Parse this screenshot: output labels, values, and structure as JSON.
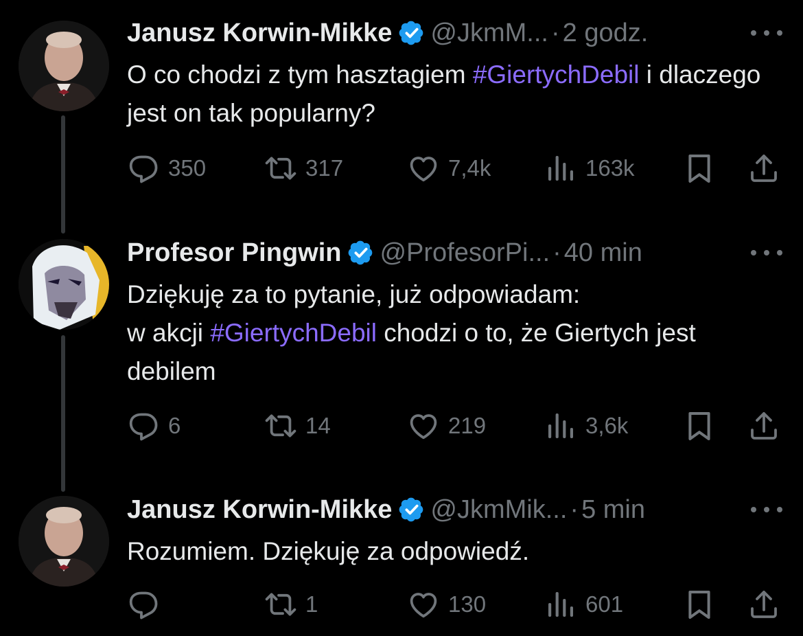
{
  "tweets": [
    {
      "name": "Janusz Korwin-Mikke",
      "handle": "@JkmM...",
      "dot": "·",
      "time": "2 godz.",
      "text_before": "O co chodzi z tym hasztagiem ",
      "hashtag": "#GiertychDebil",
      "text_after": " i dlaczego jest on tak popularny?",
      "replies": "350",
      "retweets": "317",
      "likes": "7,4k",
      "views": "163k"
    },
    {
      "name": "Profesor Pingwin",
      "handle": "@ProfesorPi...",
      "dot": "·",
      "time": "40 min",
      "text_line1": "Dziękuję za to pytanie, już odpowiadam:",
      "text_before": "w akcji ",
      "hashtag": "#GiertychDebil",
      "text_after": " chodzi o to, że Giertych jest debilem",
      "replies": "6",
      "retweets": "14",
      "likes": "219",
      "views": "3,6k"
    },
    {
      "name": "Janusz Korwin-Mikke",
      "handle": "@JkmMik...",
      "dot": "·",
      "time": "5 min",
      "text": "Rozumiem. Dziękuję za odpowiedź.",
      "replies": "",
      "retweets": "1",
      "likes": "130",
      "views": "601"
    }
  ],
  "colors": {
    "background": "#000000",
    "text": "#e7e9ea",
    "secondary": "#71767b",
    "hashtag": "#8b6cff",
    "verified": "#1d9bf0",
    "thread_line": "#333639"
  },
  "icons": [
    "reply-icon",
    "retweet-icon",
    "like-icon",
    "views-icon",
    "bookmark-icon",
    "share-icon",
    "more-icon",
    "verified-badge-icon"
  ]
}
